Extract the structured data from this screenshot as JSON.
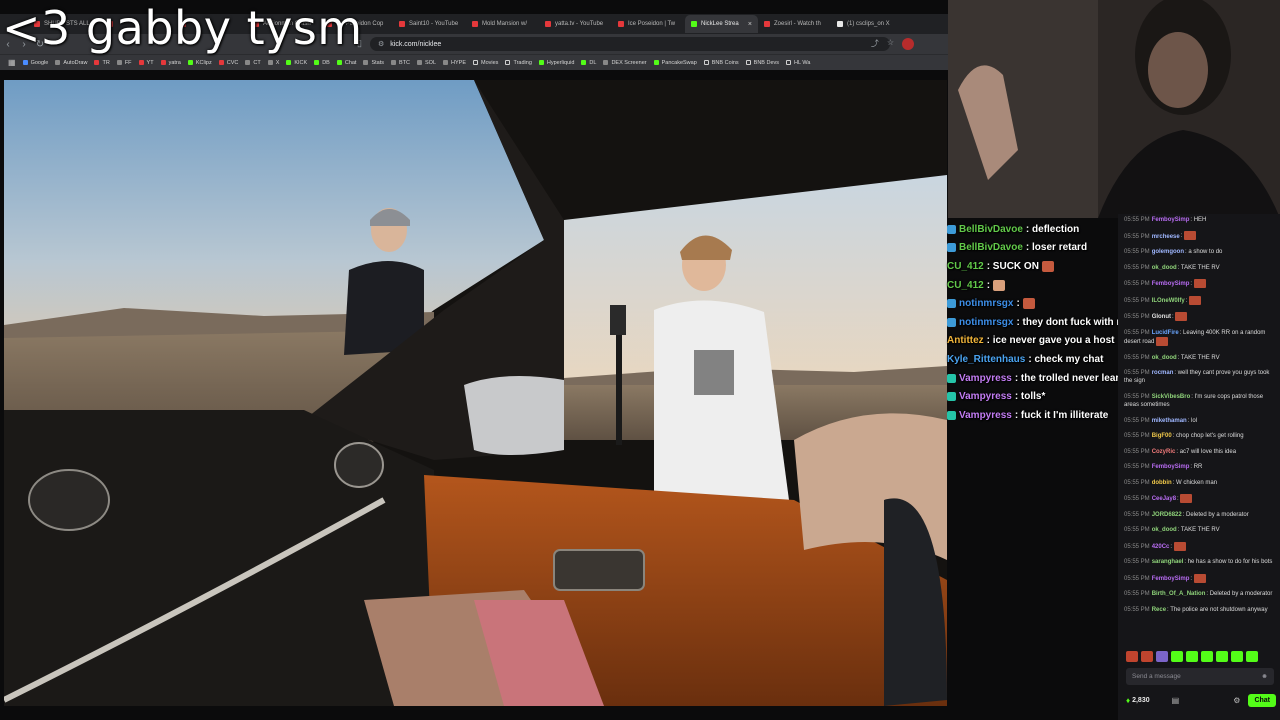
{
  "overlay_title": "<3 gabby tysm",
  "browser": {
    "tabs": [
      {
        "label": "SHUBZ STS ALL"
      },
      {
        "label": ""
      },
      {
        "label": ""
      },
      {
        "label": "Ac7ionman Crash"
      },
      {
        "label": "Ice Poseidon Cop"
      },
      {
        "label": "Saint10 - YouTube"
      },
      {
        "label": "Mold Mansion w/"
      },
      {
        "label": "yatta.tv - YouTube"
      },
      {
        "label": "Ice Poseidon | Tw"
      },
      {
        "label": "NickLee Strea",
        "active": true
      },
      {
        "label": "Zoesirl - Watch th"
      },
      {
        "label": "(1) csclips_on X"
      }
    ],
    "url": "kick.com/nicklee",
    "bookmarks": [
      "Google",
      "AutoDraw",
      "TR",
      "FF",
      "YT",
      "yatra",
      "KClipz",
      "CVC",
      "CT",
      "X",
      "KICK",
      "DB",
      "Chat",
      "Stats",
      "BTC",
      "SOL",
      "HYPE",
      "Movies",
      "Trading",
      "Hyperliquid",
      "DL",
      "DEX Screener",
      "PancakeSwap",
      "BNB Coins",
      "BNB Devs",
      "HL Wa"
    ]
  },
  "overlay_chat": [
    {
      "user": "BellBivDavoe",
      "color": "#62c94a",
      "badge": "sub",
      "message": ": deflection"
    },
    {
      "user": "BellBivDavoe",
      "color": "#62c94a",
      "badge": "sub",
      "message": ": loser retard"
    },
    {
      "user": "CU_412",
      "color": "#62c94a",
      "badge": "",
      "message": ": SUCK ON",
      "emote": true
    },
    {
      "user": "CU_412",
      "color": "#62c94a",
      "badge": "",
      "message": ":",
      "emote": true
    },
    {
      "user": "notinmrsgx",
      "color": "#3d8ee8",
      "badge": "sub",
      "message": ":",
      "emote": true
    },
    {
      "user": "notinmrsgx",
      "color": "#3d8ee8",
      "badge": "sub",
      "message": ": they dont fuck with me gang"
    },
    {
      "user": "Antittez",
      "color": "#f0b43a",
      "badge": "",
      "message": ": ice never gave you a host"
    },
    {
      "user": "Kyle_Rittenhaus",
      "color": "#4aa3f0",
      "badge": "",
      "message": ": check my chat"
    },
    {
      "user": "Vampyress",
      "color": "#c27cf2",
      "badge": "mod",
      "message": ": the trolled never learn eh"
    },
    {
      "user": "Vampyress",
      "color": "#c27cf2",
      "badge": "mod",
      "message": ": tolls*"
    },
    {
      "user": "Vampyress",
      "color": "#c27cf2",
      "badge": "mod",
      "message": ": fuck it I'm illiterate"
    }
  ],
  "kick_chat": {
    "messages": [
      {
        "time": "05:55 PM",
        "user": "FemboySimp",
        "color": "#b86cf2",
        "text": ": HEH"
      },
      {
        "time": "05:55 PM",
        "user": "mrcheese",
        "color": "#9fb7ff",
        "text": ":",
        "emote": true
      },
      {
        "time": "05:55 PM",
        "user": "golemgoon",
        "color": "#9fb7ff",
        "text": ": a show to do"
      },
      {
        "time": "05:55 PM",
        "user": "ok_dood",
        "color": "#8fd37a",
        "text": ": TAKE THE RV"
      },
      {
        "time": "05:55 PM",
        "user": "FemboySimp",
        "color": "#b86cf2",
        "text": ":",
        "emote": true
      },
      {
        "time": "05:55 PM",
        "user": "ILOneW0lfy",
        "color": "#8fd37a",
        "text": ":",
        "emote": true
      },
      {
        "time": "05:55 PM",
        "user": "Glonut",
        "color": "#e0e0e0",
        "text": ":",
        "emote": true
      },
      {
        "time": "05:55 PM",
        "user": "LucidFire",
        "color": "#6aa6ff",
        "text": ": Leaving 400K RR on a random desert road",
        "emote": true
      },
      {
        "time": "05:55 PM",
        "user": "ok_dood",
        "color": "#8fd37a",
        "text": ": TAKE THE RV"
      },
      {
        "time": "05:55 PM",
        "user": "rocman",
        "color": "#9fb7ff",
        "text": ": well they cant prove you guys took the sign"
      },
      {
        "time": "05:55 PM",
        "user": "SickVibesBro",
        "color": "#8fd37a",
        "text": ": I'm sure cops patrol those areas sometimes"
      },
      {
        "time": "05:55 PM",
        "user": "mikethaman",
        "color": "#9fb7ff",
        "text": ": lol"
      },
      {
        "time": "05:55 PM",
        "user": "BigF00",
        "color": "#f0c84a",
        "text": ": chop chop let's get rolling"
      },
      {
        "time": "05:55 PM",
        "user": "CozyRic",
        "color": "#f07a7a",
        "text": ": ac7 will love this idea"
      },
      {
        "time": "05:55 PM",
        "user": "FemboySimp",
        "color": "#b86cf2",
        "text": ": RR"
      },
      {
        "time": "05:55 PM",
        "user": "dobbin",
        "color": "#f0c84a",
        "text": ": W chicken man"
      },
      {
        "time": "05:55 PM",
        "user": "CeeJay8",
        "color": "#b86cf2",
        "text": ":",
        "emote": true
      },
      {
        "time": "05:55 PM",
        "user": "JORD6822",
        "color": "#8fd37a",
        "text": ": Deleted by a moderator"
      },
      {
        "time": "05:55 PM",
        "user": "ok_dood",
        "color": "#8fd37a",
        "text": ": TAKE THE RV"
      },
      {
        "time": "05:55 PM",
        "user": "420Cc",
        "color": "#b86cf2",
        "text": ":",
        "emote": true
      },
      {
        "time": "05:55 PM",
        "user": "saranghael",
        "color": "#8fd37a",
        "text": ": he has a show to do for his bots"
      },
      {
        "time": "05:55 PM",
        "user": "FemboySimp",
        "color": "#b86cf2",
        "text": ":",
        "emote": true
      },
      {
        "time": "05:55 PM",
        "user": "Birth_Of_A_Nation",
        "color": "#8fd37a",
        "text": ": Deleted by a moderator"
      },
      {
        "time": "05:55 PM",
        "user": "Rece",
        "color": "#8fd37a",
        "text": ": The police are not shutdown anyway"
      }
    ],
    "input_placeholder": "Send a message",
    "points": "2,830",
    "chat_button": "Chat"
  },
  "colors": {
    "kick_green": "#53fc18",
    "chat_bg": "#151518"
  }
}
